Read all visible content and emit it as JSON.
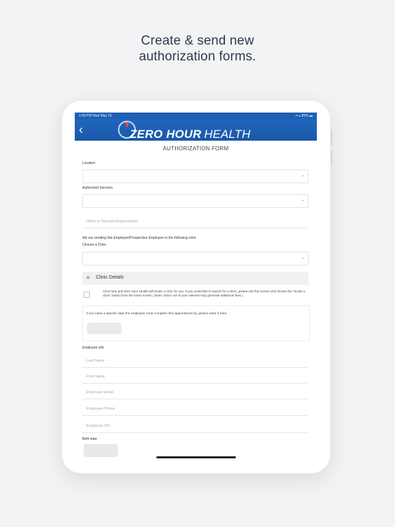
{
  "headline": {
    "line1": "Create & send new",
    "line2": "authorization forms."
  },
  "status_bar": {
    "time_date": "1:58 PM   Wed May 15",
    "right": "•• ▴ 85% ▬"
  },
  "nav": {
    "back_glyph": "‹",
    "logo_part1": "ZERO HOUR",
    "logo_part2": "HEALTH"
  },
  "form": {
    "title": "AUTHORIZATION FORM",
    "location_label": "Location",
    "services_label": "Authorized Services",
    "special_placeholder": "Other or Special Requirements",
    "sending_text": "We are sending this Employee/Prospective Employee to the following clinic",
    "clinic_label": "Choose a Clinic",
    "chevron": "⌄",
    "section_icon": "≡",
    "section_title": "Clinic Details",
    "check_text": "Click here and Zero Hour Health will locate a clinic for you. If you would like to search for a clinic, please exit this screen and choose the \"locate a clinic\" button from the home screen. (Note: clinics out of your network may generate additional fees.)",
    "date_text": "If you have a specific date the employee must complete this appointment by, please enter it here.",
    "employee_label": "Employee info",
    "fields": [
      "Last Name",
      "First Name",
      "Employee Email",
      "Employee Phone",
      "Employee ID#"
    ],
    "birth_label": "Birth date"
  }
}
